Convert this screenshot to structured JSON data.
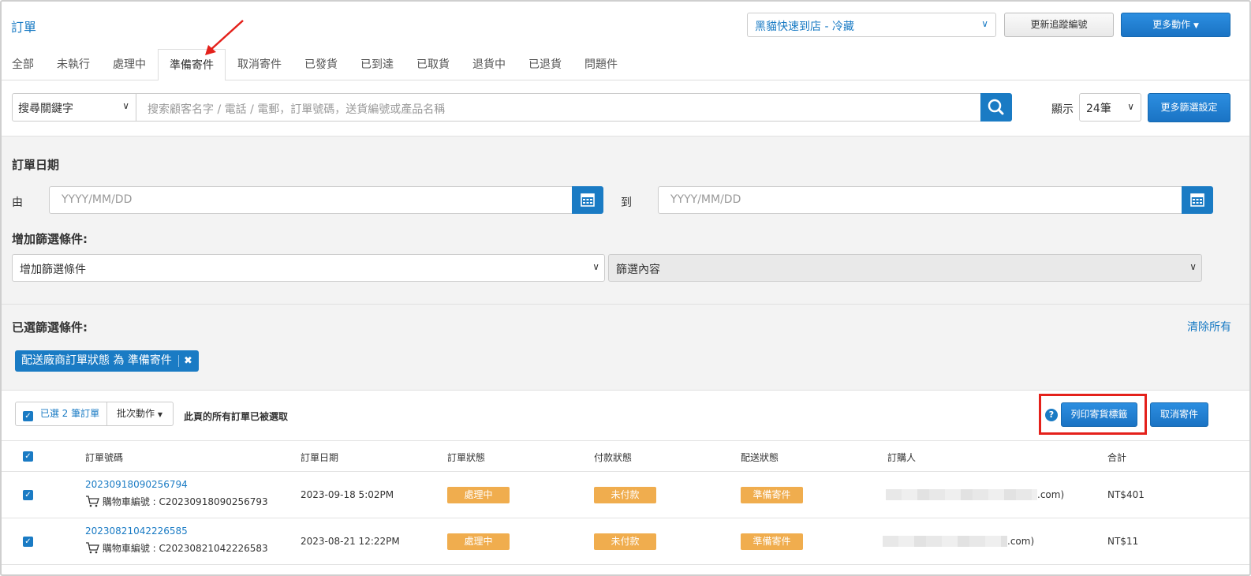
{
  "header": {
    "title": "訂單",
    "store_select": "黑貓快速到店 - 冷藏",
    "update_tracking_label": "更新追蹤編號",
    "more_actions_label": "更多動作"
  },
  "tabs": [
    {
      "label": "全部"
    },
    {
      "label": "未執行"
    },
    {
      "label": "處理中"
    },
    {
      "label": "準備寄件"
    },
    {
      "label": "取消寄件"
    },
    {
      "label": "已發貨"
    },
    {
      "label": "已到達"
    },
    {
      "label": "已取貨"
    },
    {
      "label": "退貨中"
    },
    {
      "label": "已退貨"
    },
    {
      "label": "問題件"
    }
  ],
  "active_tab": "準備寄件",
  "search": {
    "keyword_select": "搜尋關鍵字",
    "placeholder": "搜索顧客名字 / 電話 / 電郵，訂單號碼，送貨編號或產品名稱",
    "show_label": "顯示",
    "per_page": "24筆",
    "more_filters_label": "更多篩選設定"
  },
  "filters": {
    "order_date_heading": "訂單日期",
    "from_label": "由",
    "to_label": "到",
    "date_placeholder": "YYYY/MM/DD",
    "add_filter_heading": "增加篩選條件:",
    "add_filter_select": "增加篩選條件",
    "filter_content_select": "篩選內容",
    "selected_heading": "已選篩選條件:",
    "clear_all": "清除所有",
    "chip_label": "配送廠商訂單狀態 為 準備寄件"
  },
  "bulk": {
    "selected_label": "已選 2 筆訂單",
    "batch_label": "批次動作",
    "all_selected_text": "此頁的所有訂單已被選取",
    "print_label": "列印寄貨標籤",
    "cancel_label": "取消寄件"
  },
  "table": {
    "headers": [
      "訂單號碼",
      "訂單日期",
      "訂單狀態",
      "付款狀態",
      "配送狀態",
      "訂購人",
      "合計"
    ],
    "rows": [
      {
        "order_no": "20230918090256794",
        "cart_no": "購物車編號 : C20230918090256793",
        "date": "2023-09-18 5:02PM",
        "order_status": "處理中",
        "payment_status": "未付款",
        "delivery_status": "準備寄件",
        "buyer_suffix": ".com)",
        "total": "NT$401"
      },
      {
        "order_no": "20230821042226585",
        "cart_no": "購物車編號 : C20230821042226583",
        "date": "2023-08-21 12:22PM",
        "order_status": "處理中",
        "payment_status": "未付款",
        "delivery_status": "準備寄件",
        "buyer_suffix": ".com)",
        "total": "NT$11"
      }
    ]
  },
  "colors": {
    "accent": "#1a7bc4",
    "badge": "#f0ad4e",
    "highlight": "#e4211b"
  }
}
